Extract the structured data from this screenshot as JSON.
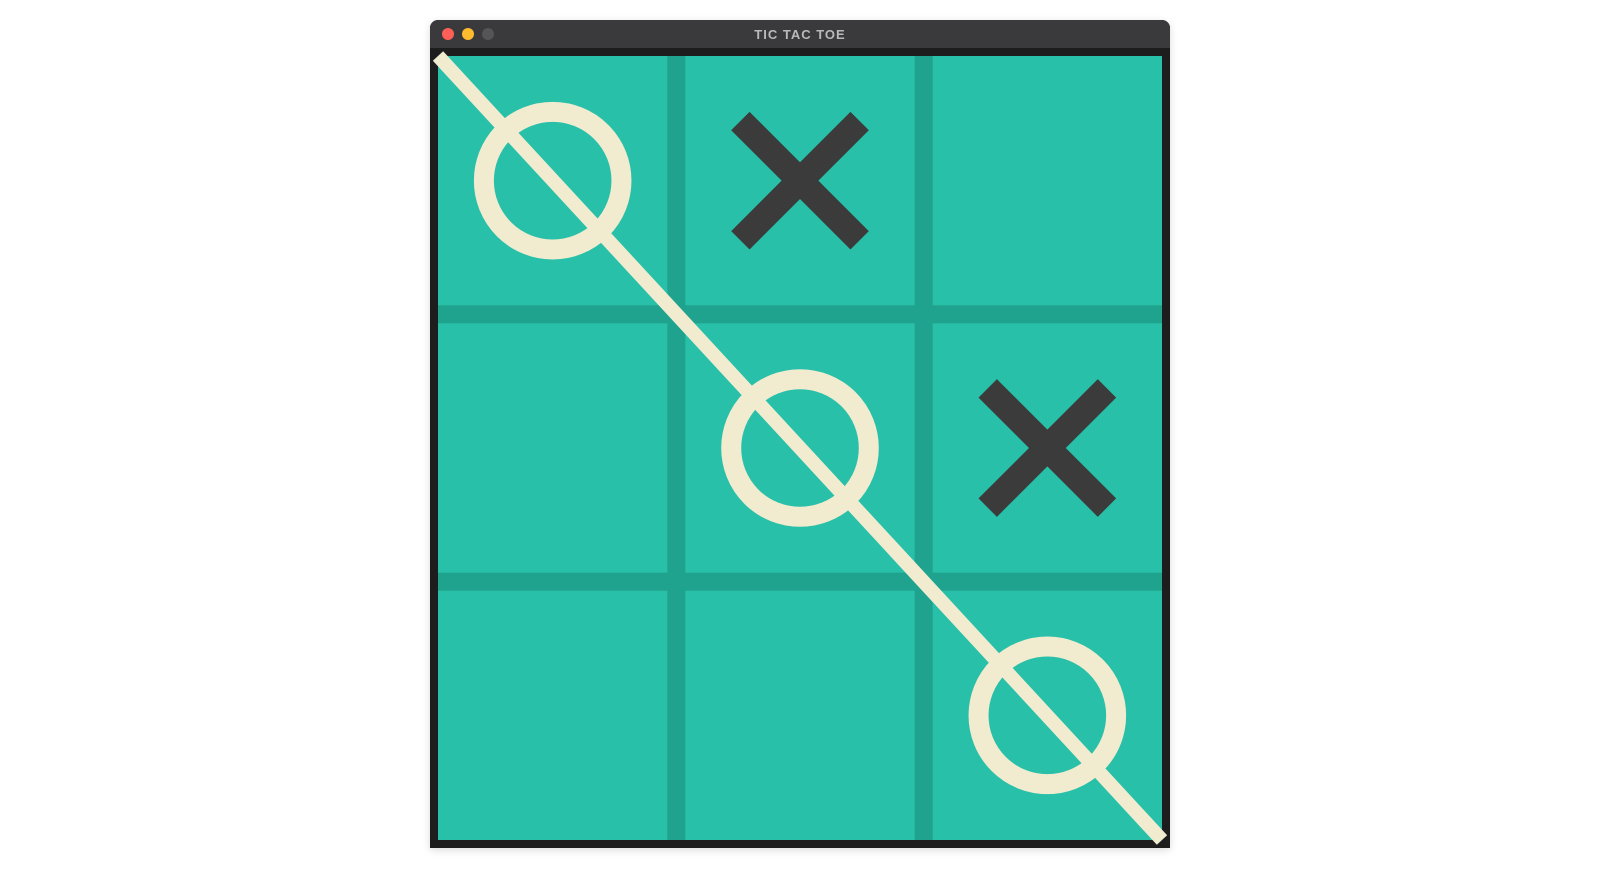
{
  "window": {
    "title": "TIC TAC TOE"
  },
  "colors": {
    "board_bg": "#28c0a8",
    "grid_line": "#1fa38e",
    "x_mark": "#3b3b3b",
    "o_mark": "#f1ebcf",
    "win_line": "#f1ebcf",
    "titlebar_bg": "#3a3a3c",
    "titlebar_text": "#b9b9b9"
  },
  "game": {
    "grid_size": 3,
    "board": [
      [
        "O",
        "X",
        ""
      ],
      [
        "",
        "O",
        "X"
      ],
      [
        "",
        "",
        "O"
      ]
    ],
    "winner": "O",
    "win_line": {
      "type": "diagonal-main",
      "from": [
        0,
        0
      ],
      "to": [
        2,
        2
      ]
    }
  }
}
